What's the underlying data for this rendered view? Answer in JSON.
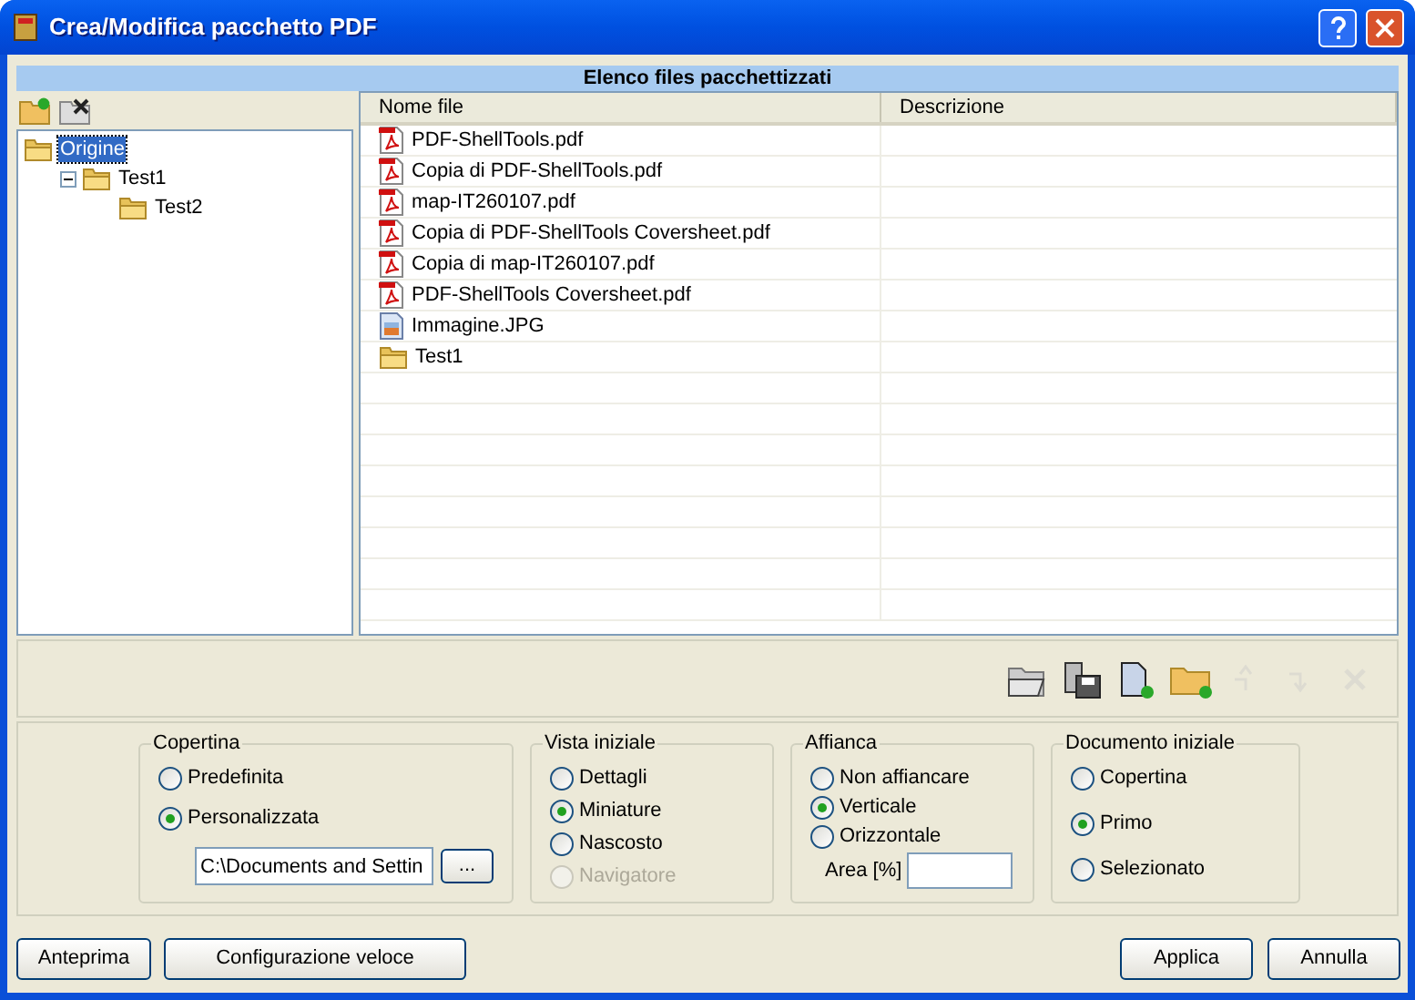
{
  "window": {
    "title": "Crea/Modifica pacchetto PDF"
  },
  "section_title": "Elenco files pacchettizzati",
  "tree": [
    {
      "label": "Origine",
      "selected": true,
      "children": [
        {
          "label": "Test1",
          "selected": false,
          "expanded": true,
          "children": [
            {
              "label": "Test2",
              "selected": false
            }
          ]
        }
      ]
    }
  ],
  "table": {
    "columns": [
      "Nome file",
      "Descrizione"
    ],
    "rows": [
      {
        "kind": "pdf",
        "name": "PDF-ShellTools.pdf"
      },
      {
        "kind": "pdf",
        "name": "Copia di PDF-ShellTools.pdf"
      },
      {
        "kind": "pdf",
        "name": "map-IT260107.pdf"
      },
      {
        "kind": "pdf",
        "name": "Copia di PDF-ShellTools Coversheet.pdf"
      },
      {
        "kind": "pdf",
        "name": "Copia di map-IT260107.pdf"
      },
      {
        "kind": "pdf",
        "name": "PDF-ShellTools Coversheet.pdf"
      },
      {
        "kind": "image",
        "name": "Immagine.JPG"
      },
      {
        "kind": "folder",
        "name": "Test1"
      }
    ]
  },
  "toolbar": [
    {
      "kind": "open",
      "disabled": false
    },
    {
      "kind": "save",
      "disabled": false
    },
    {
      "kind": "new-file",
      "disabled": false
    },
    {
      "kind": "new-folder",
      "disabled": false
    },
    {
      "kind": "up",
      "disabled": true
    },
    {
      "kind": "down",
      "disabled": true
    },
    {
      "kind": "delete",
      "disabled": true
    }
  ],
  "groups": [
    {
      "title": "Copertina",
      "options": [
        {
          "label": "Predefinita",
          "selected": false,
          "disabled": false
        },
        {
          "label": "Personalizzata",
          "selected": true,
          "disabled": false
        }
      ],
      "path_field": {
        "value": "C:\\Documents and Settin",
        "button": "..."
      }
    },
    {
      "title": "Vista iniziale",
      "options": [
        {
          "label": "Dettagli",
          "selected": false,
          "disabled": false
        },
        {
          "label": "Miniature",
          "selected": true,
          "disabled": false
        },
        {
          "label": "Nascosto",
          "selected": false,
          "disabled": false
        },
        {
          "label": "Navigatore",
          "selected": false,
          "disabled": true
        }
      ]
    },
    {
      "title": "Affianca",
      "options": [
        {
          "label": "Non affiancare",
          "selected": false,
          "disabled": false
        },
        {
          "label": "Verticale",
          "selected": true,
          "disabled": false
        },
        {
          "label": "Orizzontale",
          "selected": false,
          "disabled": false
        }
      ],
      "area_field": {
        "label": "Area [%]"
      }
    },
    {
      "title": "Documento iniziale",
      "options": [
        {
          "label": "Copertina",
          "selected": false,
          "disabled": false
        },
        {
          "label": "Primo",
          "selected": true,
          "disabled": false
        },
        {
          "label": "Selezionato",
          "selected": false,
          "disabled": false
        }
      ]
    }
  ],
  "buttons_left": [
    "Anteprima",
    "Configurazione veloce"
  ],
  "buttons_right": [
    "Applica",
    "Annulla"
  ]
}
